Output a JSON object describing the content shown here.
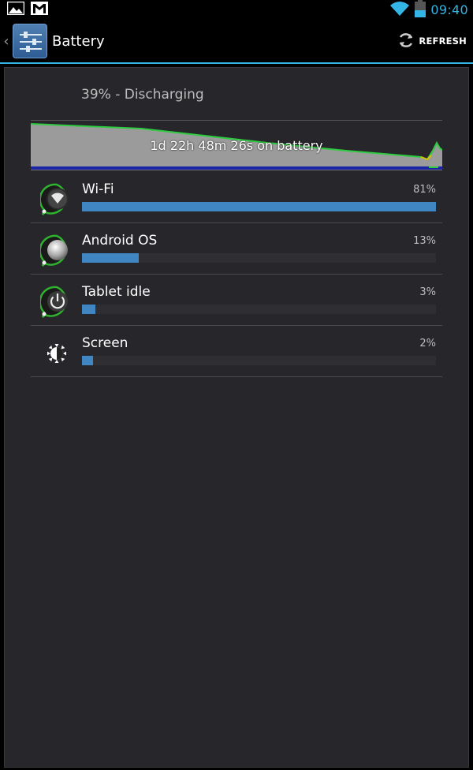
{
  "status_bar": {
    "time": "09:40",
    "icons": [
      "picture-icon",
      "gmail-icon",
      "wifi-icon",
      "battery-icon"
    ]
  },
  "action_bar": {
    "title": "Battery",
    "refresh_label": "REFRESH"
  },
  "battery": {
    "status": "39% - Discharging",
    "graph_caption": "1d 22h 48m 26s on battery"
  },
  "usage": [
    {
      "label": "Wi-Fi",
      "percent": "81%",
      "level": 81,
      "icon": "wifi-app-icon"
    },
    {
      "label": "Android OS",
      "percent": "13%",
      "level": 13,
      "icon": "android-os-icon"
    },
    {
      "label": "Tablet idle",
      "percent": "3%",
      "level": 3,
      "icon": "power-icon"
    },
    {
      "label": "Screen",
      "percent": "2%",
      "level": 2,
      "icon": "brightness-icon"
    }
  ],
  "colors": {
    "accent": "#33b5e5",
    "bar": "#3f86c2",
    "graph_line": "#33cc33"
  }
}
